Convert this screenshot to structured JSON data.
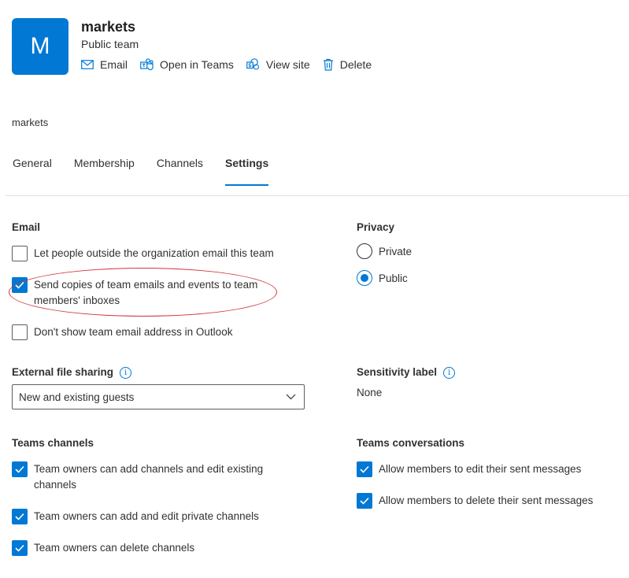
{
  "header": {
    "avatar_letter": "M",
    "team_name": "markets",
    "team_type": "Public team",
    "actions": [
      {
        "label": "Email",
        "icon": "mail-icon"
      },
      {
        "label": "Open in Teams",
        "icon": "teams-icon"
      },
      {
        "label": "View site",
        "icon": "sharepoint-icon"
      },
      {
        "label": "Delete",
        "icon": "trash-icon"
      }
    ]
  },
  "breadcrumb": "markets",
  "tabs": [
    {
      "label": "General",
      "active": false
    },
    {
      "label": "Membership",
      "active": false
    },
    {
      "label": "Channels",
      "active": false
    },
    {
      "label": "Settings",
      "active": true
    }
  ],
  "email": {
    "title": "Email",
    "options": [
      {
        "label": "Let people outside the organization email this team",
        "checked": false
      },
      {
        "label": "Send copies of team emails and events to team members' inboxes",
        "checked": true
      },
      {
        "label": "Don't show team email address in Outlook",
        "checked": false
      }
    ]
  },
  "privacy": {
    "title": "Privacy",
    "options": [
      {
        "label": "Private",
        "selected": false
      },
      {
        "label": "Public",
        "selected": true
      }
    ]
  },
  "external_sharing": {
    "title": "External file sharing",
    "value": "New and existing guests"
  },
  "sensitivity": {
    "title": "Sensitivity label",
    "value": "None"
  },
  "teams_channels": {
    "title": "Teams channels",
    "options": [
      {
        "label": "Team owners can add channels and edit existing channels",
        "checked": true
      },
      {
        "label": "Team owners can add and edit private channels",
        "checked": true
      },
      {
        "label": "Team owners can delete channels",
        "checked": true
      }
    ]
  },
  "teams_conversations": {
    "title": "Teams conversations",
    "options": [
      {
        "label": "Allow members to edit their sent messages",
        "checked": true
      },
      {
        "label": "Allow members to delete their sent messages",
        "checked": true
      }
    ]
  },
  "colors": {
    "accent": "#0078d4",
    "annotation": "#d13438",
    "text": "#323130",
    "divider": "#e1dfdd"
  }
}
